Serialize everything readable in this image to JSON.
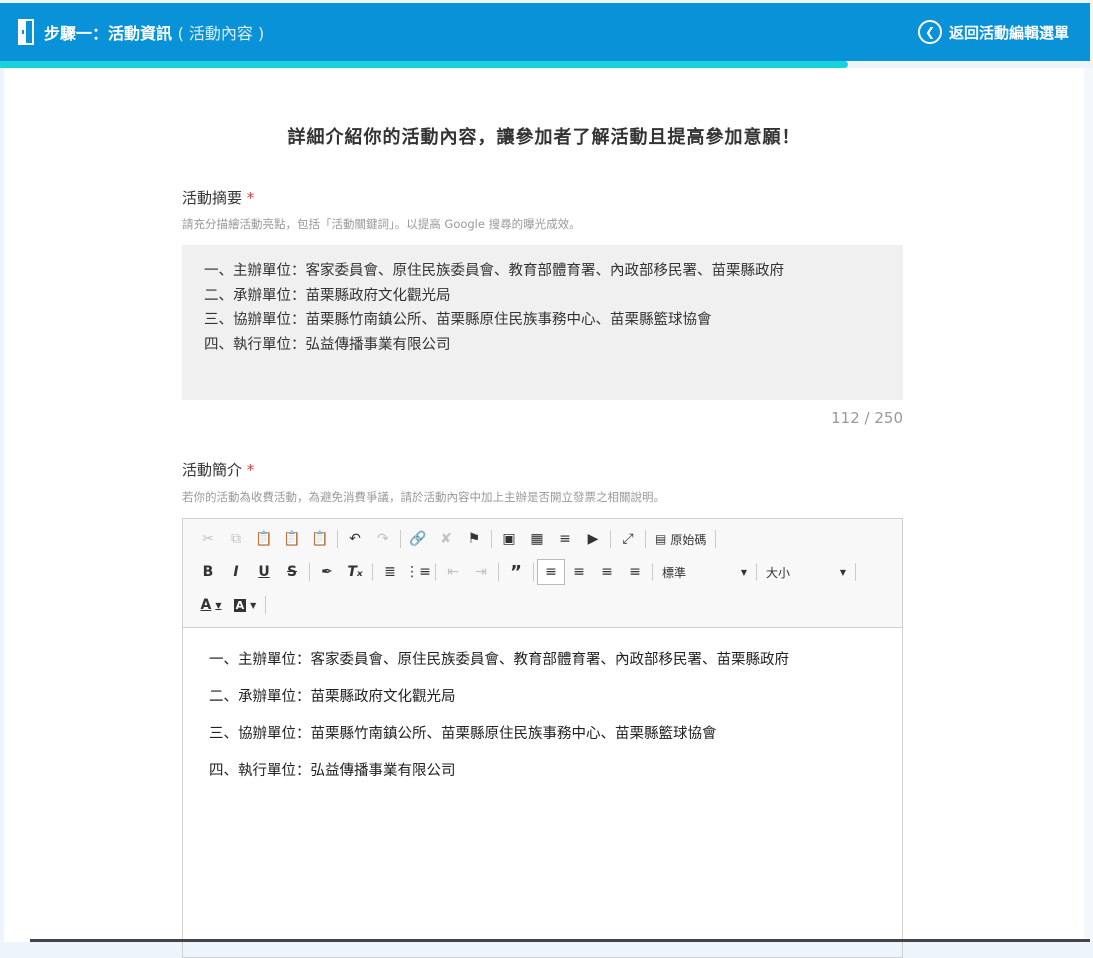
{
  "header": {
    "title": "步驟一：活動資訊",
    "subtitle": "( 活動內容 )",
    "back_label": "返回活動編輯選單",
    "bg_color": "#0a92d8",
    "progress_color": "#17d3df"
  },
  "progress": {
    "value_percent": 77.6
  },
  "headline": "詳細介紹你的活動內容，讓參加者了解活動且提高參加意願！",
  "summary_field": {
    "label": "活動摘要",
    "required_mark": "*",
    "hint": "請充分描繪活動亮點，包括「活動關鍵詞」。以提高 Google 搜尋的曝光成效。",
    "lines": [
      "一、主辦單位：客家委員會、原住民族委員會、教育部體育署、內政部移民署、苗栗縣政府",
      "二、承辦單位：苗栗縣政府文化觀光局",
      "三、協辦單位：苗栗縣竹南鎮公所、苗栗縣原住民族事務中心、苗栗縣籃球協會",
      "四、執行單位：弘益傳播事業有限公司"
    ],
    "counter": "112 / 250"
  },
  "intro_field": {
    "label": "活動簡介",
    "required_mark": "*",
    "hint": "若你的活動為收費活動，為避免消費爭議，請於活動內容中加上主辦是否開立發票之相關說明。",
    "toolbar": {
      "source_label": "原始碼",
      "format_label": "標準",
      "size_label": "大小"
    },
    "content": [
      "一、主辦單位：客家委員會、原住民族委員會、教育部體育署、內政部移民署、苗栗縣政府",
      "二、承辦單位：苗栗縣政府文化觀光局",
      "三、協辦單位：苗栗縣竹南鎮公所、苗栗縣原住民族事務中心、苗栗縣籃球協會",
      "四、執行單位：弘益傳播事業有限公司"
    ]
  }
}
